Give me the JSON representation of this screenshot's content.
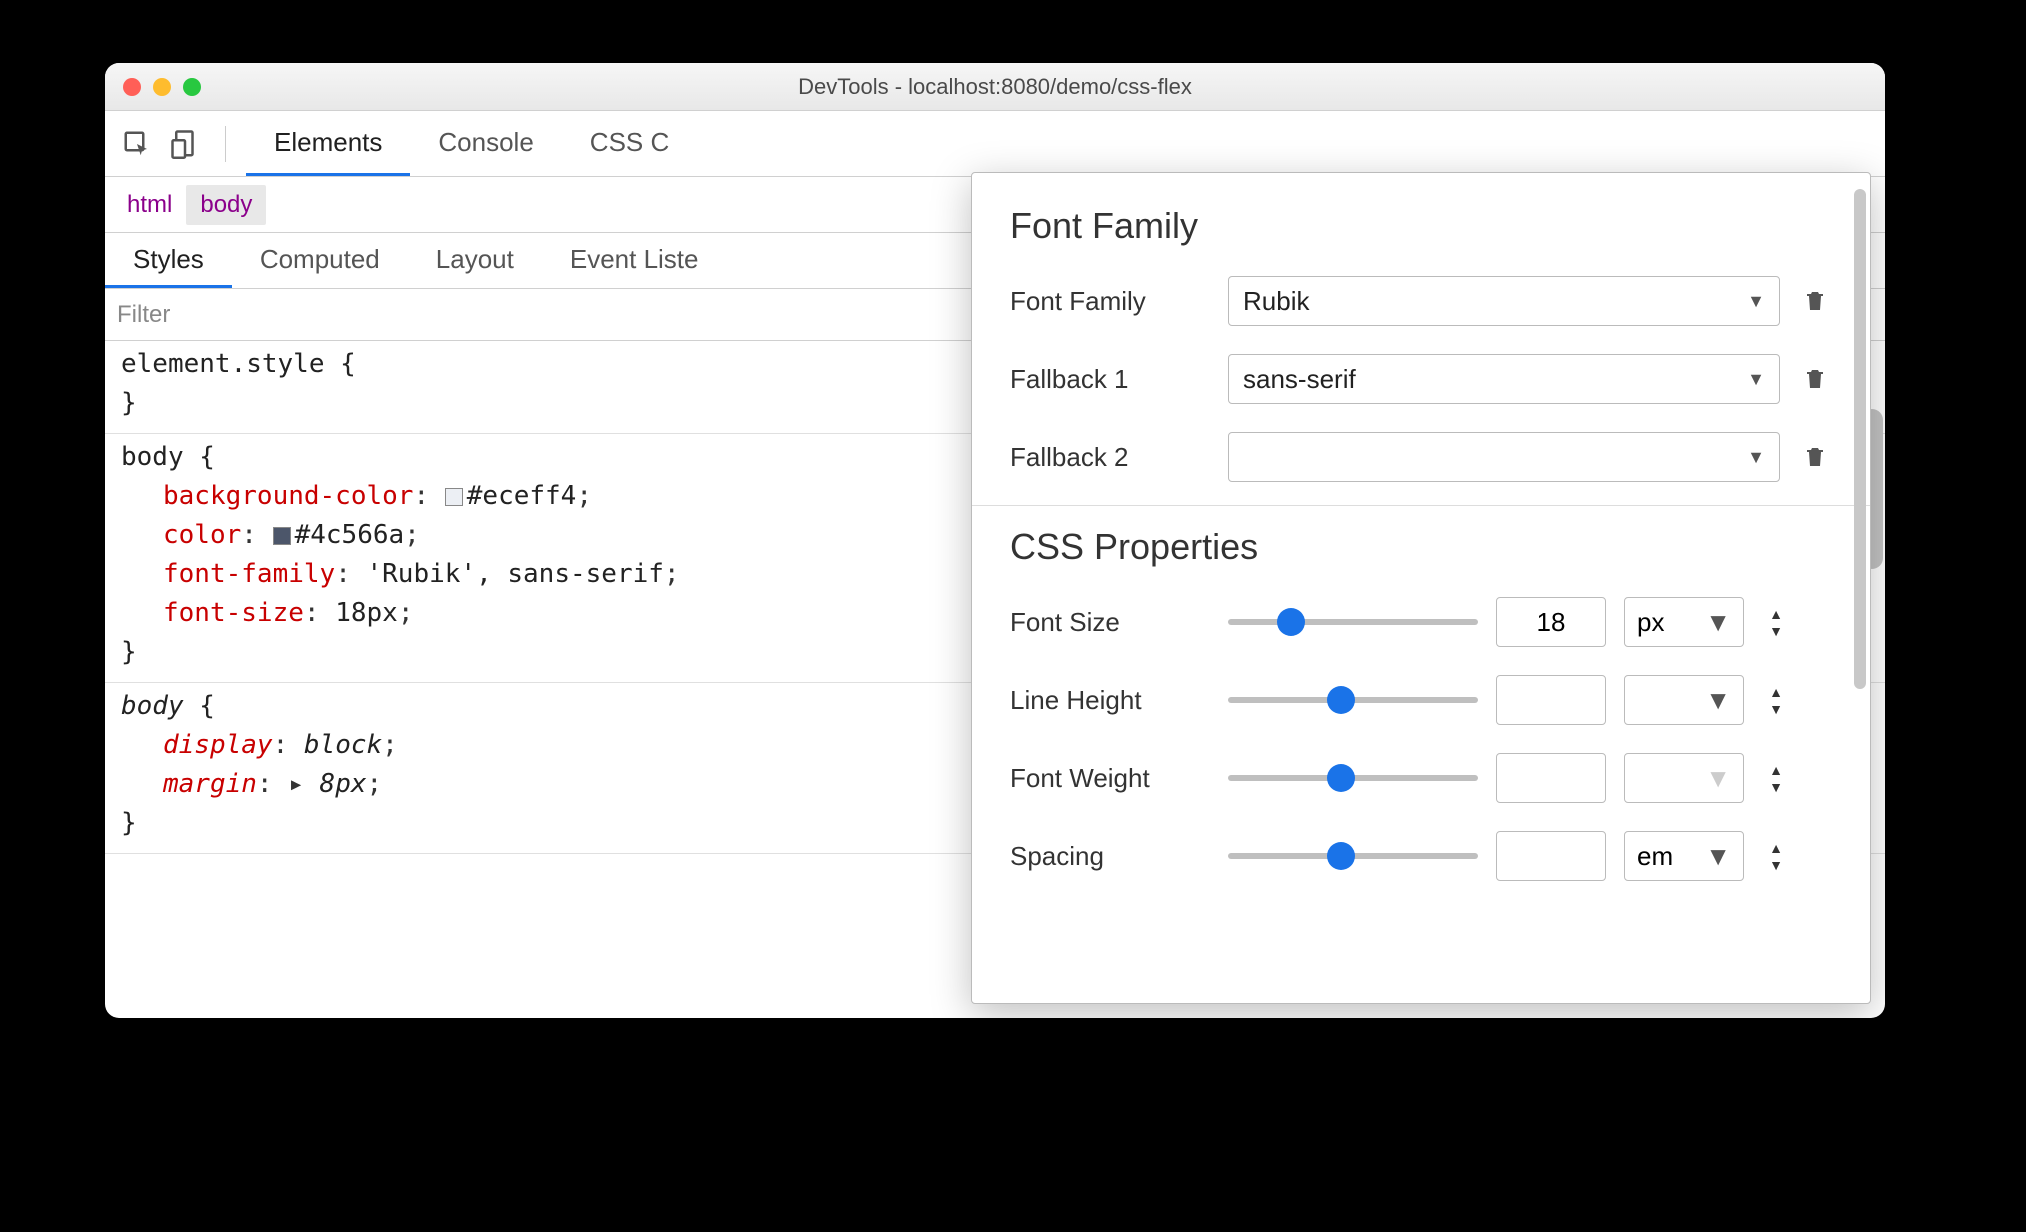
{
  "window": {
    "title": "DevTools - localhost:8080/demo/css-flex"
  },
  "toolbar": {
    "tabs": [
      "Elements",
      "Console",
      "CSS Overview"
    ],
    "active_tab": 0
  },
  "breadcrumb": [
    "html",
    "body"
  ],
  "subtabs": [
    "Styles",
    "Computed",
    "Layout",
    "Event Listeners"
  ],
  "filter_placeholder": "Filter",
  "rules": [
    {
      "selector": "element.style",
      "declarations": []
    },
    {
      "selector": "body",
      "declarations": [
        {
          "prop": "background-color",
          "value": "#eceff4",
          "swatch": "#eceff4"
        },
        {
          "prop": "color",
          "value": "#4c566a",
          "swatch": "#4c566a"
        },
        {
          "prop": "font-family",
          "value": "'Rubik', sans-serif"
        },
        {
          "prop": "font-size",
          "value": "18px"
        }
      ]
    },
    {
      "selector": "body",
      "italic": true,
      "declarations": [
        {
          "prop": "display",
          "value": "block"
        },
        {
          "prop": "margin",
          "value": "8px",
          "expand": true
        }
      ]
    }
  ],
  "font_panel": {
    "section1_title": "Font Family",
    "family_rows": [
      {
        "label": "Font Family",
        "value": "Rubik"
      },
      {
        "label": "Fallback 1",
        "value": "sans-serif"
      },
      {
        "label": "Fallback 2",
        "value": ""
      }
    ],
    "section2_title": "CSS Properties",
    "props": [
      {
        "label": "Font Size",
        "value": "18",
        "unit": "px",
        "thumb": 25
      },
      {
        "label": "Line Height",
        "value": "",
        "unit": "",
        "thumb": 45
      },
      {
        "label": "Font Weight",
        "value": "",
        "unit": "",
        "thumb": 45,
        "unit_disabled": true
      },
      {
        "label": "Spacing",
        "value": "",
        "unit": "em",
        "thumb": 45
      }
    ]
  }
}
